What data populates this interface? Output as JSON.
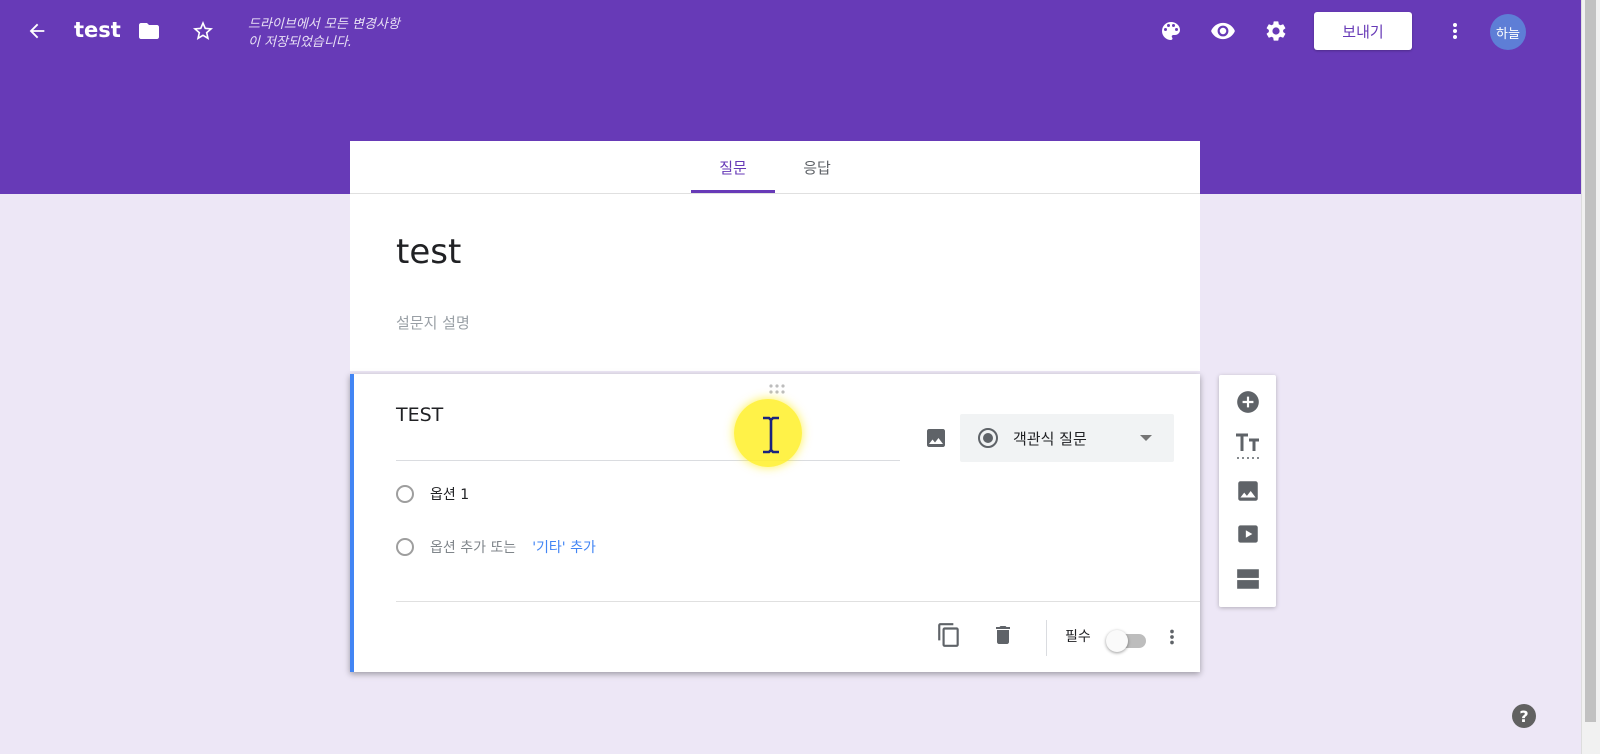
{
  "header": {
    "title": "test",
    "save_status_line1": "드라이브에서 모든 변경사항",
    "save_status_line2": "이 저장되었습니다.",
    "send_label": "보내기",
    "avatar_text": "하늘",
    "icons": [
      "back-arrow-icon",
      "folder-icon",
      "star-icon",
      "palette-icon",
      "preview-eye-icon",
      "settings-gear-icon",
      "more-vert-icon"
    ]
  },
  "tabs": [
    {
      "label": "질문",
      "active": true
    },
    {
      "label": "응답",
      "active": false
    }
  ],
  "form": {
    "title": "test",
    "description_placeholder": "설문지 설명"
  },
  "question": {
    "title": "TEST",
    "type_label": "객관식 질문",
    "options": [
      {
        "label": "옵션 1"
      }
    ],
    "add_option_label": "옵션 추가 또는",
    "add_other_label": "'기타' 추가",
    "required_label": "필수",
    "required": false
  },
  "side_toolbar": {
    "icons": [
      "add-question-icon",
      "add-title-icon",
      "add-image-icon",
      "add-video-icon",
      "add-section-icon"
    ]
  },
  "help": {
    "label": "?"
  },
  "colors": {
    "accent": "#673ab7",
    "background": "#ede7f6",
    "question_focus": "#4285f4",
    "link": "#4285f4"
  }
}
